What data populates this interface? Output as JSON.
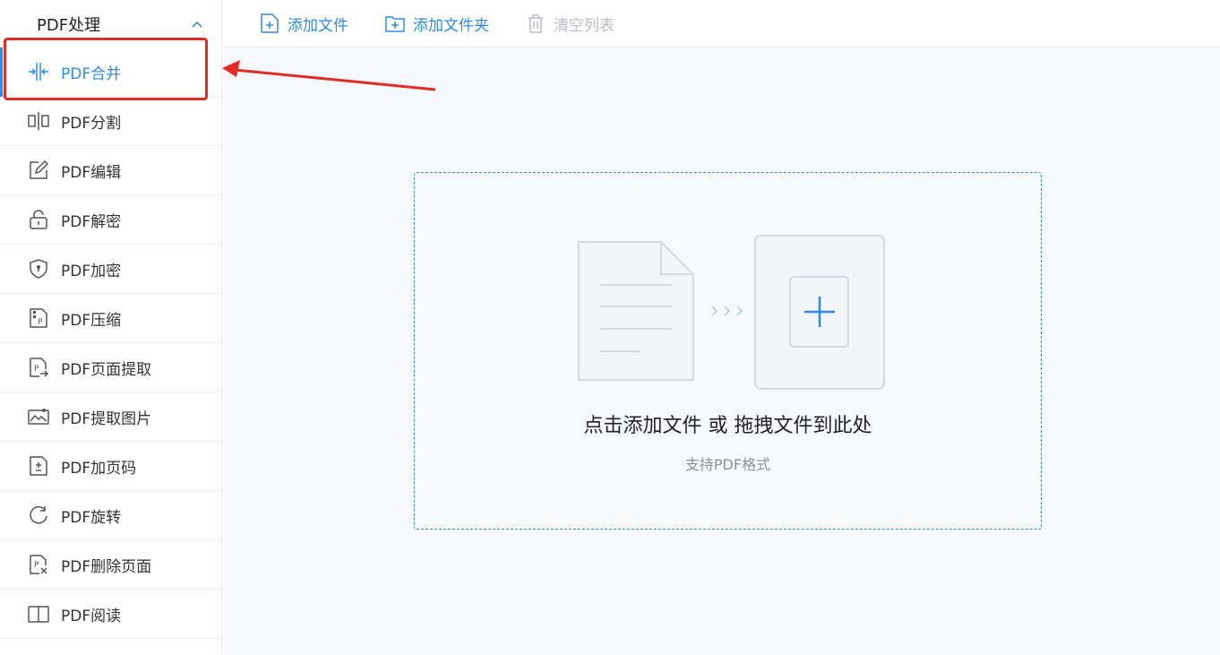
{
  "sidebar": {
    "title": "PDF处理",
    "items": [
      {
        "label": "PDF合并",
        "icon": "merge-icon",
        "active": true
      },
      {
        "label": "PDF分割",
        "icon": "split-icon"
      },
      {
        "label": "PDF编辑",
        "icon": "edit-icon"
      },
      {
        "label": "PDF解密",
        "icon": "unlock-icon"
      },
      {
        "label": "PDF加密",
        "icon": "shield-lock-icon"
      },
      {
        "label": "PDF压缩",
        "icon": "compress-icon"
      },
      {
        "label": "PDF页面提取",
        "icon": "page-extract-icon"
      },
      {
        "label": "PDF提取图片",
        "icon": "image-extract-icon"
      },
      {
        "label": "PDF加页码",
        "icon": "page-number-icon"
      },
      {
        "label": "PDF旋转",
        "icon": "rotate-icon"
      },
      {
        "label": "PDF删除页面",
        "icon": "delete-page-icon"
      },
      {
        "label": "PDF阅读",
        "icon": "book-icon"
      }
    ]
  },
  "toolbar": {
    "add_file": "添加文件",
    "add_folder": "添加文件夹",
    "clear_list": "清空列表"
  },
  "dropzone": {
    "main_text": "点击添加文件 或 拖拽文件到此处",
    "sub_text": "支持PDF格式"
  },
  "colors": {
    "accent": "#2f8be0",
    "highlight": "#e32b24",
    "disabled": "#b9bec6"
  }
}
